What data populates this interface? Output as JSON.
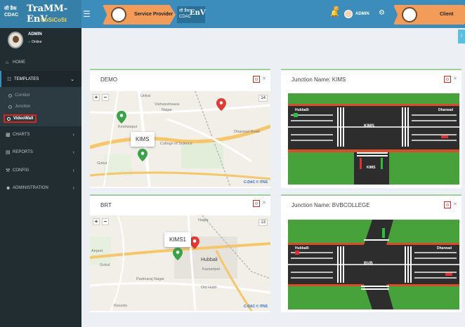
{
  "header": {
    "logo_cdac_line1": "सी डैक",
    "logo_cdac_line2": "CDAC",
    "logo_title": "TraMM-EnV",
    "logo_subtitle": "CoSiCoSt",
    "service_provider_label": "Service Provider",
    "mini_logo_top": "सी डैक",
    "mini_logo_bottom": "CDAC",
    "mini_logo_env": "EnV",
    "notification_count": "2",
    "user_name": "ADMIN",
    "client_label": "Client",
    "icons": [
      "hamburger-icon",
      "bell-icon",
      "share-icon"
    ]
  },
  "sidebar": {
    "user": {
      "name": "ADMIN",
      "status": "Online"
    },
    "items": [
      {
        "label": "HOME",
        "icon": "home-icon"
      },
      {
        "label": "TEMPLATES",
        "icon": "columns-icon",
        "active": true
      },
      {
        "label": "CHARTS",
        "icon": "bar-chart-icon"
      },
      {
        "label": "REPORTS",
        "icon": "report-icon"
      },
      {
        "label": "CONFIG",
        "icon": "wrench-icon"
      },
      {
        "label": "ADMINISTRATION",
        "icon": "users-icon"
      }
    ],
    "templates_sub": [
      {
        "label": "Corridor"
      },
      {
        "label": "Junction"
      },
      {
        "label": "VideoWall",
        "active": true
      }
    ]
  },
  "panels": {
    "demo": {
      "title": "DEMO",
      "zoom_level": "14",
      "popup": "KIMS",
      "attribution": "C-DAC © ITNS",
      "map_labels": [
        "Vishweshwara",
        "Nagar",
        "College of Science",
        "Gokul",
        "Dharwad Road",
        "Keshwapur",
        "Unkal"
      ]
    },
    "kims": {
      "title": "Junction Name: KIMS",
      "junction_label": "KIMS",
      "road_labels": [
        "Hubballi",
        "Dharwad",
        "KIMS"
      ]
    },
    "brt": {
      "title": "BRT",
      "zoom_level": "13",
      "popup": "KIMS1",
      "attribution": "C-DAC © ITNS",
      "map_labels": [
        "Nagar",
        "Gokul",
        "Hubbali",
        "Kamaripet",
        "Padmaraj Nagar",
        "Old Hubli",
        "Airport",
        "Resorts"
      ]
    },
    "bvb": {
      "title": "Junction Name: BVBCOLLEGE",
      "junction_label": "BVB",
      "road_labels": [
        "Hubballi",
        "Dharwad"
      ]
    }
  },
  "colors": {
    "header_blue": "#3c8dbc",
    "sidebar_dark": "#222d32",
    "pill_orange": "#f39c5a",
    "panel_border_green": "#9fd29b",
    "highlight_red": "#d9251c",
    "grass_green": "#48a23b"
  }
}
